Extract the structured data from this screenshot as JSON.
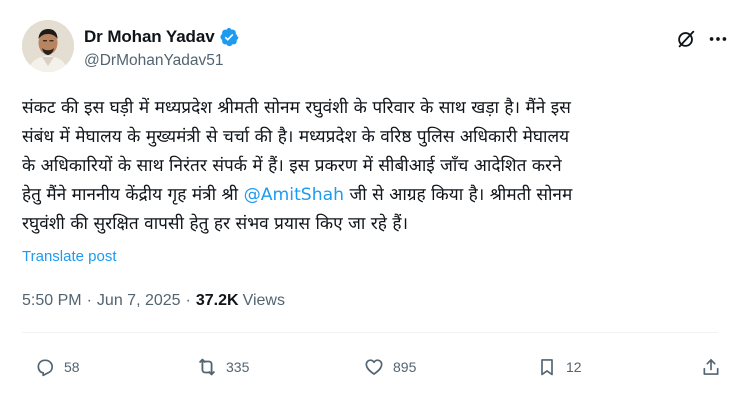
{
  "author": {
    "display_name": "Dr Mohan Yadav",
    "handle": "@DrMohanYadav51"
  },
  "tweet": {
    "lines": [
      "संकट की इस घड़ी में मध्यप्रदेश श्रीमती सोनम रघुवंशी के परिवार के साथ खड़ा है। मैंने इस",
      "संबंध में मेघालय के मुख्यमंत्री से चर्चा की है। मध्यप्रदेश के वरिष्ठ पुलिस अधिकारी मेघालय",
      "के अधिकारियों के साथ निरंतर संपर्क में हैं। इस प्रकरण में सीबीआई जाँच आदेशित करने"
    ],
    "line4_before": "हेतु मैंने माननीय केंद्रीय गृह मंत्री श्री ",
    "mention": "@AmitShah",
    "line4_after": " जी से आग्रह किया है। श्रीमती सोनम",
    "line5": "रघुवंशी की सुरक्षित वापसी हेतु हर संभव प्रयास किए जा रहे हैं।"
  },
  "translate_label": "Translate post",
  "meta": {
    "time": "5:50 PM",
    "separator1": "·",
    "date": "Jun 7, 2025",
    "separator2": "·",
    "views_count": "37.2K",
    "views_label": "Views"
  },
  "actions": {
    "replies": "58",
    "reposts": "335",
    "likes": "895",
    "bookmarks": "12"
  },
  "colors": {
    "accent": "#1d9bf0",
    "secondary_text": "#536471",
    "primary_text": "#0f1419"
  }
}
